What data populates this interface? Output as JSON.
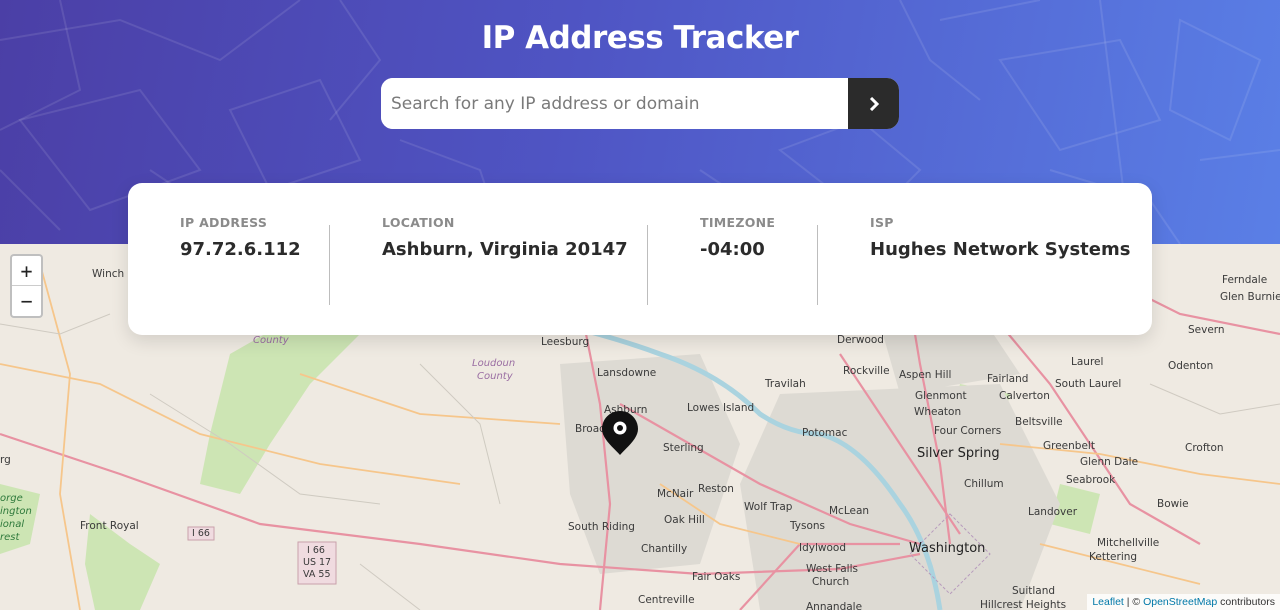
{
  "header": {
    "title": "IP Address Tracker",
    "search_placeholder": "Search for any IP address or domain",
    "search_button_icon": "chevron-right-icon",
    "gradient_colors": [
      "#4b3fa6",
      "#5a7fe6"
    ]
  },
  "info": {
    "ip_label": "IP ADDRESS",
    "ip_value": "97.72.6.112",
    "location_label": "LOCATION",
    "location_value": "Ashburn, Virginia 20147",
    "timezone_label": "TIMEZONE",
    "timezone_value": "-04:00",
    "isp_label": "ISP",
    "isp_value": "Hughes Network Systems"
  },
  "map": {
    "zoom_in": "+",
    "zoom_out": "−",
    "marker_icon": "location-pin-icon",
    "attribution": {
      "leaflet": "Leaflet",
      "separator": " | © ",
      "osm": "OpenStreetMap",
      "suffix": " contributors"
    },
    "places": {
      "winchester": "Winch",
      "county_top": "County",
      "loudoun": "Loudoun",
      "loudoun2": "County",
      "leesburg": "Leesburg",
      "lansdowne": "Lansdowne",
      "ashburn": "Ashburn",
      "broad": "Broad",
      "lowes_island": "Lowes Island",
      "sterling": "Sterling",
      "mcnair": "McNair",
      "reston": "Reston",
      "oak_hill": "Oak Hill",
      "south_riding": "South Riding",
      "chantilly": "Chantilly",
      "centreville": "Centreville",
      "fair_oaks": "Fair Oaks",
      "wolf_trap": "Wolf Trap",
      "tysons": "Tysons",
      "mclean": "McLean",
      "idylwood": "Idylwood",
      "west_falls": "West Falls",
      "church": "Church",
      "annandale": "Annandale",
      "washington": "Washington",
      "potomac": "Potomac",
      "travilah": "Travilah",
      "derwood": "Derwood",
      "rockville": "Rockville",
      "aspen_hill": "Aspen Hill",
      "glenmont": "Glenmont",
      "wheaton": "Wheaton",
      "four_corners": "Four Corners",
      "silver_spring": "Silver Spring",
      "chillum": "Chillum",
      "fairland": "Fairland",
      "calverton": "Calverton",
      "south_laurel": "South Laurel",
      "laurel": "Laurel",
      "beltsville": "Beltsville",
      "greenbelt": "Greenbelt",
      "glenn_dale": "Glenn Dale",
      "seabrook": "Seabrook",
      "bowie": "Bowie",
      "crofton": "Crofton",
      "odenton": "Odenton",
      "severn": "Severn",
      "ferndale": "Ferndale",
      "glen_burnie": "Glen Burnie",
      "landover": "Landover",
      "mitchellville": "Mitchellville",
      "kettering": "Kettering",
      "suitland": "Suitland",
      "hillcrest_heights": "Hillcrest Heights",
      "front_royal": "Front Royal",
      "i66": "I 66",
      "shield_1": "I 66",
      "shield_2": "US 17",
      "shield_3": "VA 55",
      "rg": "rg",
      "park_1": "orge",
      "park_2": "ington",
      "park_3": "ional",
      "park_4": "rest"
    }
  }
}
